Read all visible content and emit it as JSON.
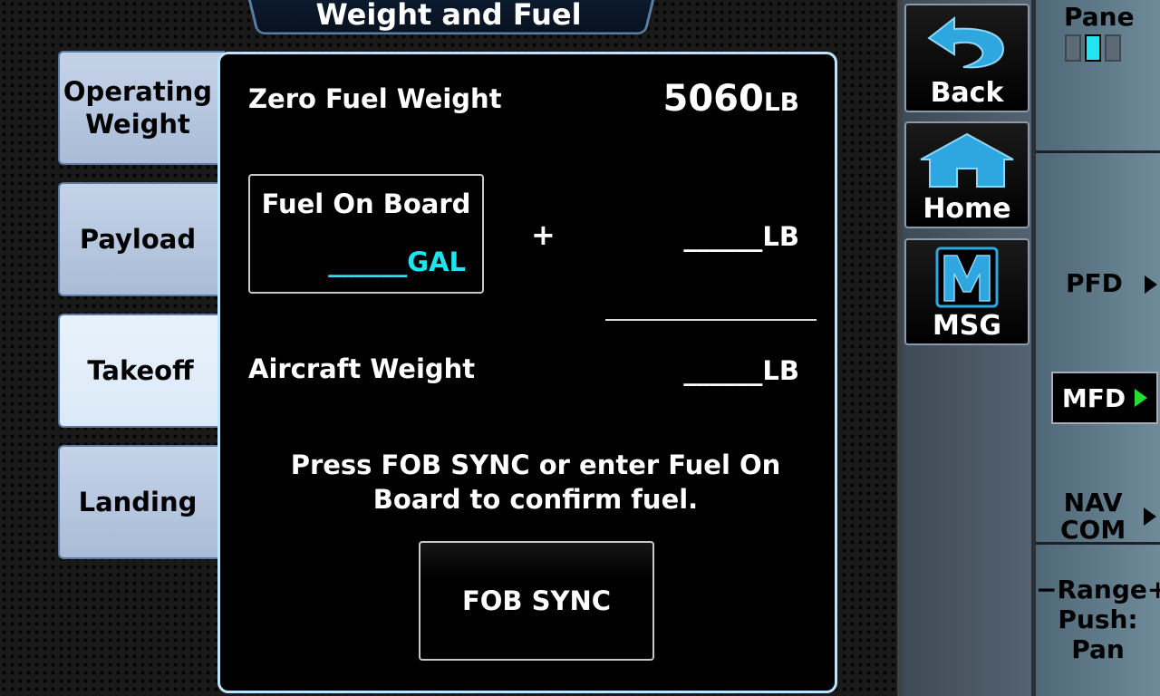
{
  "header": {
    "title": "Weight and Fuel"
  },
  "tabs": [
    {
      "label": "Operating Weight",
      "active": false
    },
    {
      "label": "Payload",
      "active": false
    },
    {
      "label": "Takeoff",
      "active": true
    },
    {
      "label": "Landing",
      "active": false
    }
  ],
  "main": {
    "zero_fuel_weight_label": "Zero Fuel Weight",
    "zero_fuel_weight_value": "5060",
    "zero_fuel_weight_unit": "LB",
    "fuel_on_board_label": "Fuel On Board",
    "fuel_on_board_value": "______",
    "fuel_on_board_unit": "GAL",
    "plus_sign": "+",
    "fuel_weight_value": "______",
    "fuel_weight_unit": "LB",
    "aircraft_weight_label": "Aircraft Weight",
    "aircraft_weight_value": "______",
    "aircraft_weight_unit": "LB",
    "instruction": "Press FOB SYNC or enter Fuel On Board to confirm fuel.",
    "fob_sync_label": "FOB SYNC"
  },
  "nav_buttons": {
    "back": "Back",
    "home": "Home",
    "msg": "MSG"
  },
  "softkeys": {
    "pane_label": "Pane",
    "pane_active_index": 1,
    "pfd": "PFD",
    "mfd": "MFD",
    "nav": "NAV",
    "com": "COM",
    "range_line1": "−Range+",
    "range_line2": "Push:",
    "range_line3": "Pan"
  },
  "colors": {
    "accent_cyan": "#1ee4f0",
    "active_arrow": "#22dd33",
    "panel_border": "#bfe4ff",
    "icon_blue": "#2ea7e0"
  },
  "icons": {
    "back": "back-arrow-icon",
    "home": "home-icon",
    "msg": "message-m-icon"
  }
}
